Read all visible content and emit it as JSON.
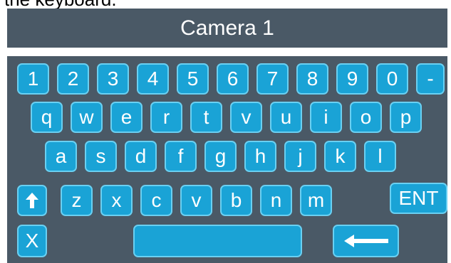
{
  "caption": "the keyboard.",
  "title": "Camera 1",
  "rows": {
    "numbers": [
      "1",
      "2",
      "3",
      "4",
      "5",
      "6",
      "7",
      "8",
      "9",
      "0",
      "-"
    ],
    "row1": [
      "q",
      "w",
      "e",
      "r",
      "t",
      "v",
      "u",
      "i",
      "o",
      "p"
    ],
    "row2": [
      "a",
      "s",
      "d",
      "f",
      "g",
      "h",
      "j",
      "k",
      "l"
    ],
    "row3": [
      "z",
      "x",
      "c",
      "v",
      "b",
      "n",
      "m"
    ]
  },
  "special": {
    "shift_icon": "arrow-up-icon",
    "enter_label": "ENT",
    "cancel_label": "X",
    "space_label": "",
    "backspace_icon": "arrow-left-icon"
  },
  "colors": {
    "panel": "#4a5966",
    "key": "#1aa3d6",
    "key_border": "#6ad0f2",
    "text": "#ffffff"
  }
}
